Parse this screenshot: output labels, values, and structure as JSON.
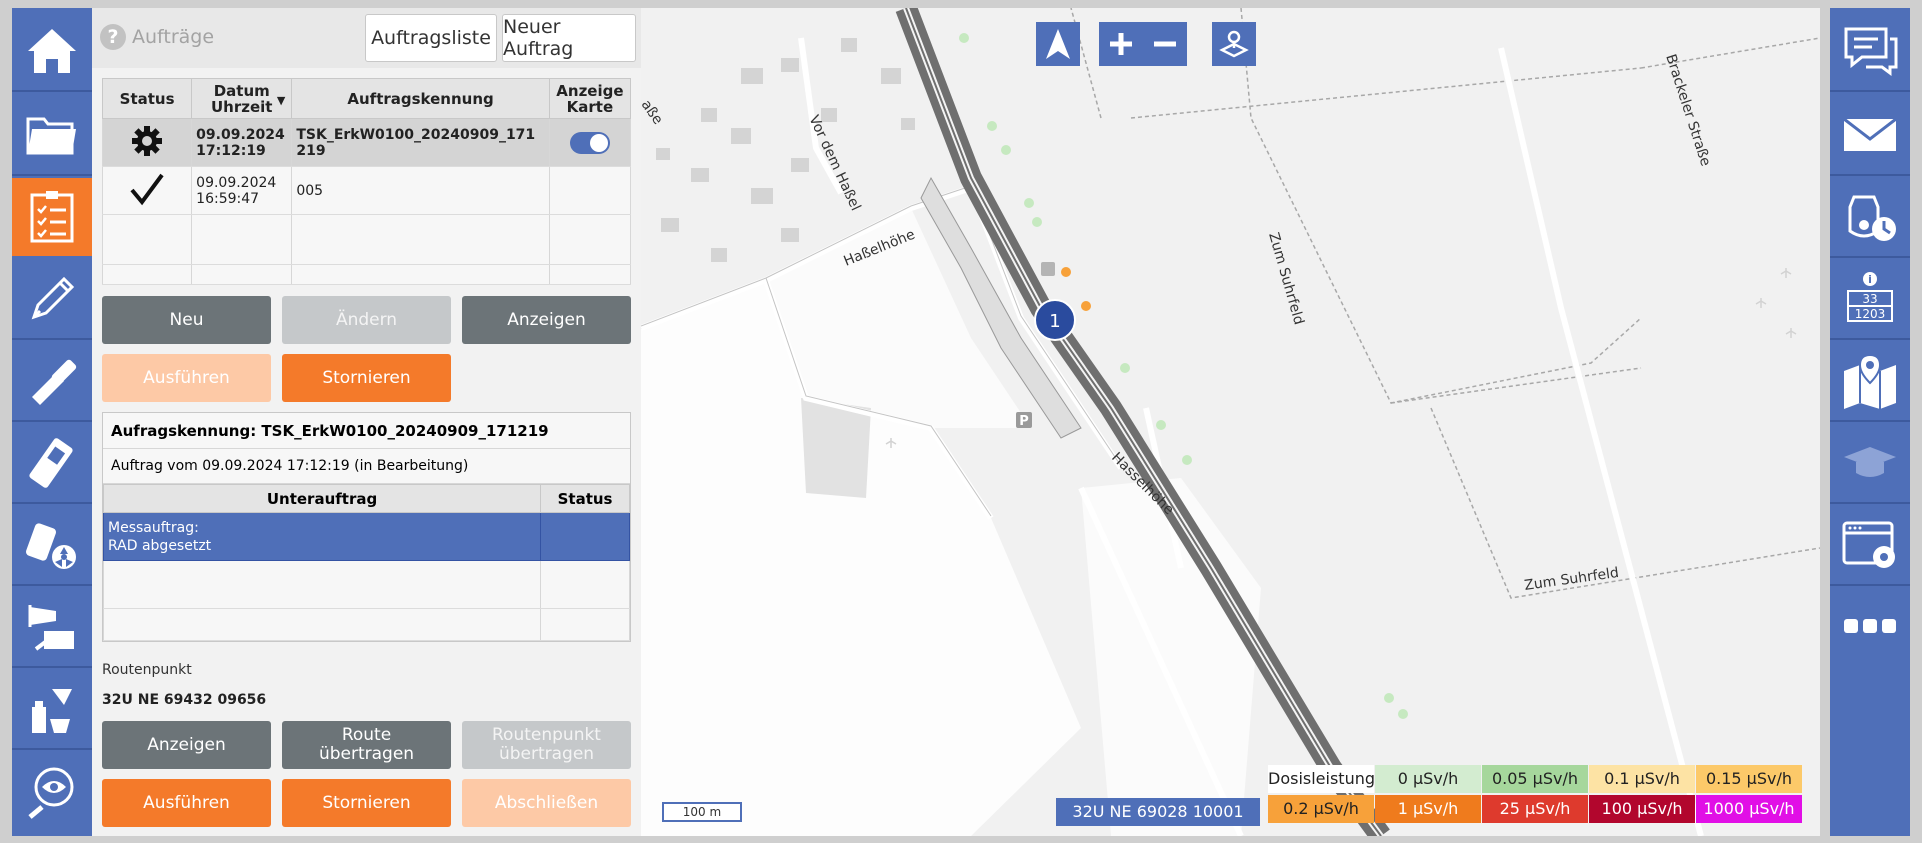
{
  "header": {
    "title": "Aufträge",
    "tab_list": "Auftragsliste",
    "tab_new": "Neuer Auftrag"
  },
  "orders_table": {
    "columns": [
      "Status",
      "Datum Uhrzeit",
      "Auftragskennung",
      "Anzeige Karte"
    ],
    "col_datum_line1": "Datum",
    "col_datum_line2": "Uhrzeit",
    "col_anzeige_line1": "Anzeige",
    "col_anzeige_line2": "Karte",
    "rows": [
      {
        "status_icon": "gear-icon",
        "date": "09.09.2024",
        "time": "17:12:19",
        "id_line1": "TSK_ErkW0100_20240909_171",
        "id_line2": "219",
        "map_toggle": "on"
      },
      {
        "status_icon": "checkmark-icon",
        "date": "09.09.2024",
        "time": "16:59:47",
        "id_line1": "005",
        "id_line2": "",
        "map_toggle": ""
      }
    ]
  },
  "order_buttons": {
    "neu": "Neu",
    "aendern": "Ändern",
    "anzeigen": "Anzeigen",
    "ausfuehren": "Ausführen",
    "stornieren": "Stornieren"
  },
  "detail": {
    "kennung": "Aufragskennung: TSK_ErkW0100_20240909_171219",
    "auftrag_vom": "Auftrag vom 09.09.2024 17:12:19 (in Bearbeitung)",
    "sub_columns": [
      "Unterauftrag",
      "Status"
    ],
    "sub_rows": [
      {
        "line1": "Messauftrag:",
        "line2": "RAD abgesetzt",
        "status": ""
      }
    ]
  },
  "route": {
    "label": "Routenpunkt",
    "value": "32U NE 69432 09656"
  },
  "route_buttons": {
    "anzeigen": "Anzeigen",
    "route_line1": "Route",
    "route_line2": "übertragen",
    "rp_line1": "Routenpunkt",
    "rp_line2": "übertragen",
    "ausfuehren": "Ausführen",
    "stornieren": "Stornieren",
    "abschliessen": "Abschließen"
  },
  "map": {
    "scale": "100 m",
    "coordinate": "32U NE 69028 10001",
    "marker": "1",
    "streets": [
      "Vor dem Haßel",
      "Haßelhöhe",
      "Hasselhöhe",
      "Zum Suhrfeld",
      "Zum Suhrfeld",
      "Brackeler Straße",
      "aße"
    ],
    "legend": {
      "title": "Dosisleistung",
      "items": [
        {
          "label": "0 µSv/h",
          "color": "#d3ecd0"
        },
        {
          "label": "0.05 µSv/h",
          "color": "#a6d79c"
        },
        {
          "label": "0.1 µSv/h",
          "color": "#fde3a4"
        },
        {
          "label": "0.15 µSv/h",
          "color": "#fcc969"
        },
        {
          "label": "0.2 µSv/h",
          "color": "#f7a13a"
        },
        {
          "label": "1 µSv/h",
          "color": "#ef7b1d"
        },
        {
          "label": "25 µSv/h",
          "color": "#de3a2d"
        },
        {
          "label": "100 µSv/h",
          "color": "#b2062d"
        },
        {
          "label": "1000 µSv/h",
          "color": "#e10fe6"
        }
      ]
    }
  },
  "colors": {
    "nav_blue": "#4f6fb8",
    "accent_orange": "#f47a2a",
    "button_gray": "#6c7478"
  }
}
